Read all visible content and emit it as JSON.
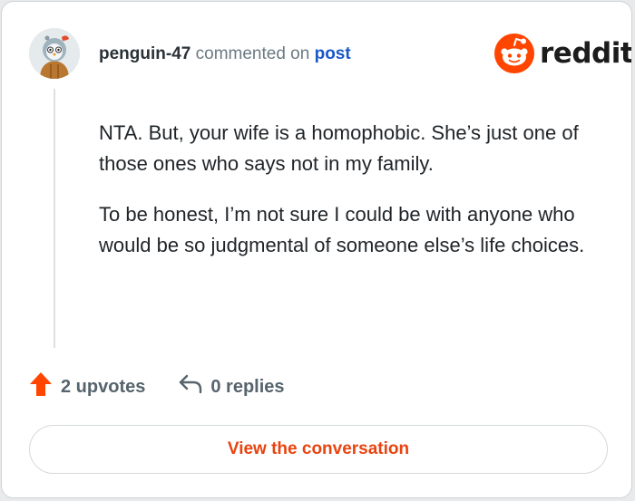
{
  "comment": {
    "username": "penguin-47",
    "action_text": "commented on",
    "target_link": "post",
    "paragraphs": [
      "NTA. But, your wife is a homophobic. She’s just one of those ones who says not in my family.",
      "To be honest, I’m not sure I could be with anyone who would be so judgmental of someone else’s life choices."
    ]
  },
  "brand": {
    "name": "reddit",
    "logo_icon": "reddit-snoo-icon",
    "accent_color": "#ff4500"
  },
  "actions": {
    "upvotes_label": "2 upvotes",
    "upvote_icon": "upvote-arrow-icon",
    "replies_label": "0 replies",
    "reply_icon": "reply-arrow-icon"
  },
  "cta": {
    "label": "View the conversation"
  },
  "colors": {
    "link": "#1a58c7",
    "cta_text": "#e8440f",
    "meta_text": "#6b7a83"
  }
}
